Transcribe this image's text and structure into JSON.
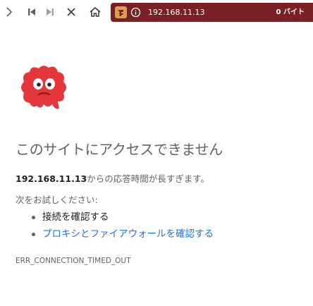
{
  "toolbar": {
    "icons": [
      "chevron-right-icon",
      "skip-back-icon",
      "skip-forward-icon",
      "close-icon",
      "home-icon"
    ],
    "site_icon": "fire-badge-icon",
    "info_icon": "info-icon",
    "url": "192.168.11.13",
    "byte_count": "0 バイト",
    "address_bar_color": "#7a1f23"
  },
  "error_page": {
    "icon": "red-monster-icon",
    "title": "このサイトにアクセスできません",
    "host": "192.168.11.13",
    "summary_suffix": "からの応答時間が長すぎます。",
    "try_heading": "次をお試しください:",
    "suggestions": [
      "接続を確認する",
      "プロキシとファイアウォールを確認する"
    ],
    "error_code": "ERR_CONNECTION_TIMED_OUT"
  },
  "colors": {
    "link": "#1a73e8",
    "text_muted": "#5f6368",
    "monster": "#e5363b"
  }
}
